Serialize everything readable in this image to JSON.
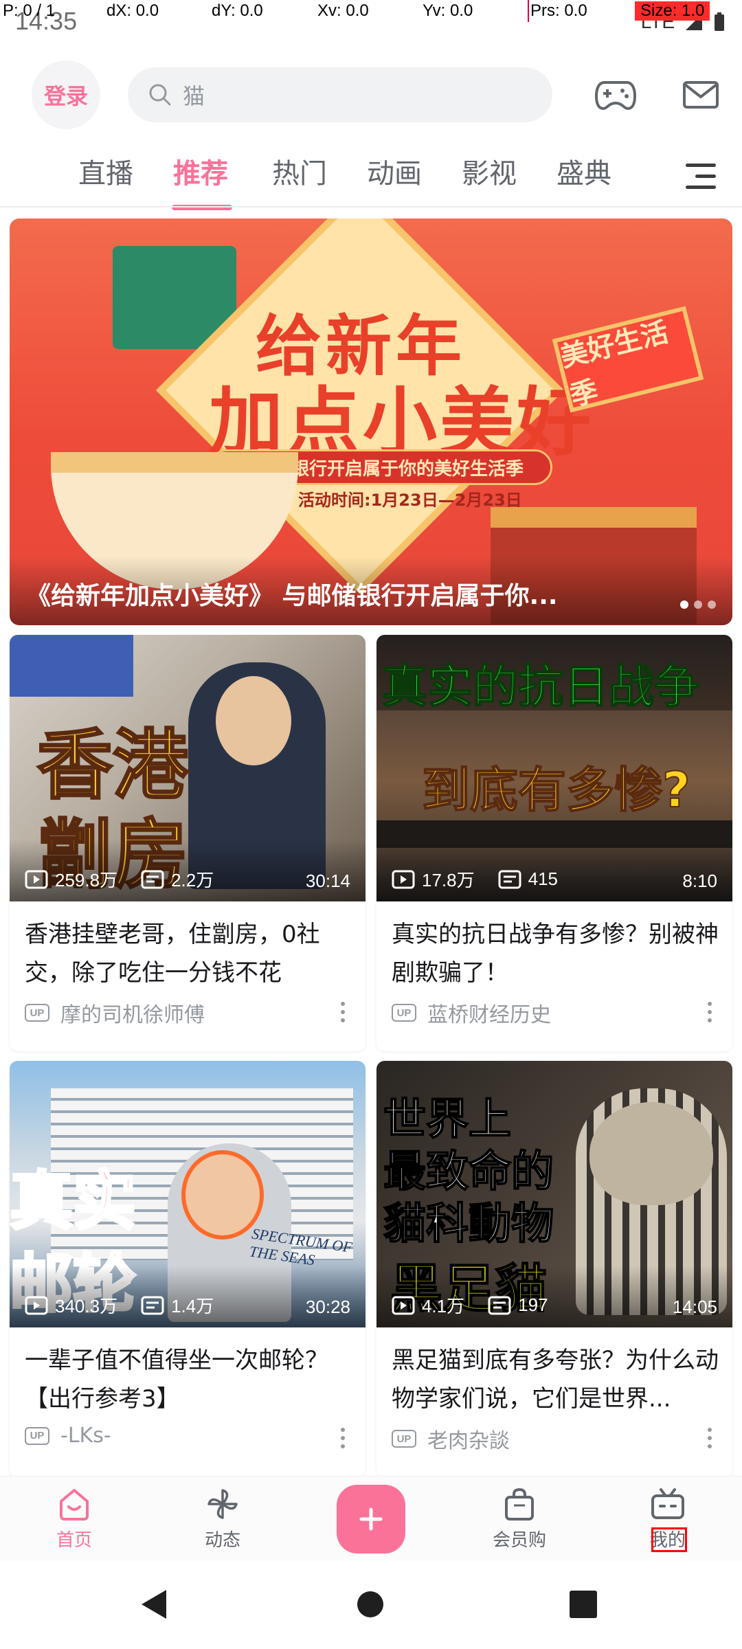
{
  "debug": {
    "p": "P: 0 / 1",
    "dx": "dX: 0.0",
    "dy": "dY: 0.0",
    "xv": "Xv: 0.0",
    "yv": "Yv: 0.0",
    "prs": "Prs: 0.0",
    "size": "Size: 1.0"
  },
  "status_bar": {
    "time": "14:35",
    "network": "LTE"
  },
  "header": {
    "login_label": "登录",
    "search_placeholder": "猫",
    "icons": [
      "gamepad-icon",
      "mail-icon"
    ]
  },
  "tabs": [
    {
      "label": "直播",
      "active": false
    },
    {
      "label": "推荐",
      "active": true
    },
    {
      "label": "热门",
      "active": false
    },
    {
      "label": "动画",
      "active": false
    },
    {
      "label": "影视",
      "active": false
    },
    {
      "label": "盛典",
      "active": false
    }
  ],
  "banner": {
    "title_line1": "给新年",
    "title_line2": "加点小美好",
    "ribbon": "与邮储银行开启属于你的美好生活季",
    "date": "活动时间:1月23日—2月23日",
    "sign": "美好生活季",
    "caption": "《给新年加点小美好》 与邮储银行开启属于你...",
    "page_count": 3,
    "current_page": 1
  },
  "feed": [
    {
      "thumb_text": [
        "香港",
        "劏房"
      ],
      "views": "259.8万",
      "danmaku": "2.2万",
      "duration": "30:14",
      "title": "香港挂壁老哥，住劏房，0社交，除了吃住一分钱不花",
      "author": "摩的司机徐师傅"
    },
    {
      "thumb_text": [
        "真实的抗日战争",
        "到底有多惨?"
      ],
      "views": "17.8万",
      "danmaku": "415",
      "duration": "8:10",
      "title": "真实的抗日战争有多惨？别被神剧欺骗了！",
      "author": "蓝桥财经历史"
    },
    {
      "thumb_text": [
        "真实",
        "邮轮",
        "SPECTRUM OF THE SEAS"
      ],
      "views": "340.3万",
      "danmaku": "1.4万",
      "duration": "30:28",
      "title": "一辈子值不值得坐一次邮轮？【出行参考3】",
      "author": "-LKs-"
    },
    {
      "thumb_text": [
        "世界上",
        "最致命的",
        "貓科動物",
        "黑足貓"
      ],
      "views": "4.1万",
      "danmaku": "197",
      "duration": "14:05",
      "title": "黑足猫到底有多夸张？为什么动物学家们说，它们是世界...",
      "author": "老肉杂談"
    }
  ],
  "up_badge": "UP",
  "bottom_nav": [
    {
      "label": "首页",
      "icon": "home-icon",
      "active": true
    },
    {
      "label": "动态",
      "icon": "pinwheel-icon",
      "active": false
    },
    {
      "label": "会员购",
      "icon": "shopping-bag-icon",
      "active": false
    },
    {
      "label": "我的",
      "icon": "tv-icon",
      "active": false
    }
  ],
  "colors": {
    "accent": "#fb7299",
    "text": "#18191c",
    "muted": "#9499a0"
  }
}
